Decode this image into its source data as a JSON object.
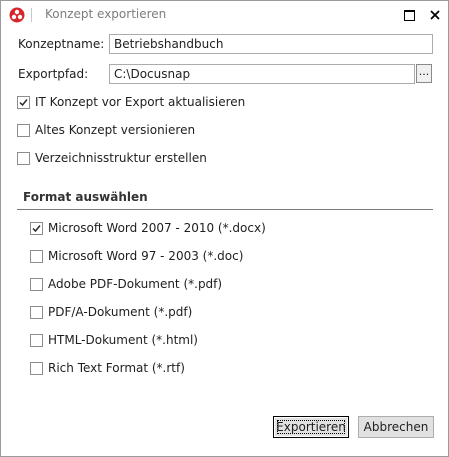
{
  "window": {
    "title": "Konzept exportieren"
  },
  "form": {
    "concept_name_label": "Konzeptname:",
    "concept_name_value": "Betriebshandbuch",
    "export_path_label": "Exportpfad:",
    "export_path_value": "C:\\Docusnap",
    "browse_label": "..."
  },
  "options": [
    {
      "label": "IT Konzept vor Export aktualisieren",
      "checked": true
    },
    {
      "label": "Altes Konzept versionieren",
      "checked": false
    },
    {
      "label": "Verzeichnisstruktur erstellen",
      "checked": false
    }
  ],
  "format_section": {
    "title": "Format auswählen",
    "formats": [
      {
        "label": "Microsoft Word 2007 - 2010 (*.docx)",
        "checked": true
      },
      {
        "label": "Microsoft Word 97 - 2003 (*.doc)",
        "checked": false
      },
      {
        "label": "Adobe PDF-Dokument (*.pdf)",
        "checked": false
      },
      {
        "label": "PDF/A-Dokument (*.pdf)",
        "checked": false
      },
      {
        "label": "HTML-Dokument (*.html)",
        "checked": false
      },
      {
        "label": "Rich Text Format (*.rtf)",
        "checked": false
      }
    ]
  },
  "buttons": {
    "export_label": "Exportieren",
    "cancel_label": "Abbrechen"
  },
  "colors": {
    "app_icon": "#d7262b",
    "border": "#9a9a9a",
    "button_face": "#e1e1e1"
  }
}
